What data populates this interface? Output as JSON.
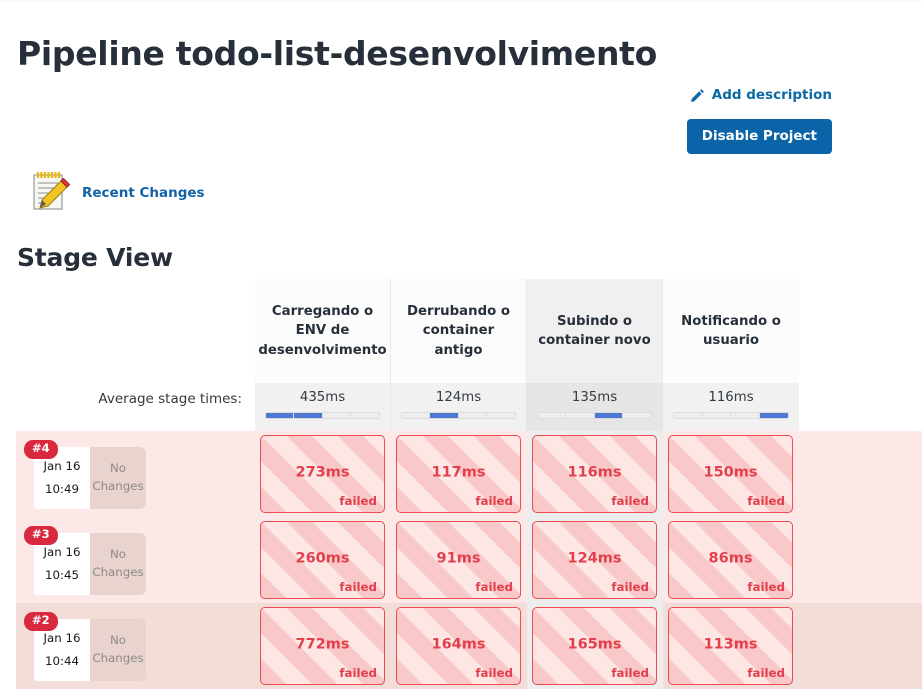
{
  "header": {
    "title": "Pipeline todo-list-desenvolvimento",
    "add_description_label": "Add description",
    "add_description_icon": "pencil-icon",
    "disable_project_label": "Disable Project",
    "accent_color": "#0b63a8",
    "link_color": "#0b6aa2"
  },
  "recent_changes": {
    "label": "Recent Changes",
    "icon": "notepad-pencil-icon"
  },
  "stage_view": {
    "title": "Stage View",
    "average_label": "Average stage times:",
    "stages": [
      {
        "name": "Carregando o ENV de desenvolvimento",
        "average": "435ms",
        "bar_segment": 1,
        "bar_fill_percent": 50,
        "highlighted": false
      },
      {
        "name": "Derrubando o container antigo",
        "average": "124ms",
        "bar_segment": 2,
        "bar_fill_percent": 25,
        "highlighted": false
      },
      {
        "name": "Subindo o container novo",
        "average": "135ms",
        "bar_segment": 3,
        "bar_fill_percent": 25,
        "highlighted": true
      },
      {
        "name": "Notificando o usuario",
        "average": "116ms",
        "bar_segment": 4,
        "bar_fill_percent": 25,
        "highlighted": false
      }
    ],
    "builds": [
      {
        "number": "#4",
        "date": "Jan 16",
        "time": "10:49",
        "changes_line1": "No",
        "changes_line2": "Changes",
        "hover": false,
        "cells": [
          {
            "duration": "273ms",
            "status": "failed"
          },
          {
            "duration": "117ms",
            "status": "failed"
          },
          {
            "duration": "116ms",
            "status": "failed"
          },
          {
            "duration": "150ms",
            "status": "failed"
          }
        ]
      },
      {
        "number": "#3",
        "date": "Jan 16",
        "time": "10:45",
        "changes_line1": "No",
        "changes_line2": "Changes",
        "hover": false,
        "cells": [
          {
            "duration": "260ms",
            "status": "failed"
          },
          {
            "duration": "91ms",
            "status": "failed"
          },
          {
            "duration": "124ms",
            "status": "failed"
          },
          {
            "duration": "86ms",
            "status": "failed"
          }
        ]
      },
      {
        "number": "#2",
        "date": "Jan 16",
        "time": "10:44",
        "changes_line1": "No",
        "changes_line2": "Changes",
        "hover": true,
        "cells": [
          {
            "duration": "772ms",
            "status": "failed"
          },
          {
            "duration": "164ms",
            "status": "failed"
          },
          {
            "duration": "165ms",
            "status": "failed"
          },
          {
            "duration": "113ms",
            "status": "failed"
          }
        ]
      }
    ],
    "colors": {
      "failed_border": "#ef4b53",
      "failed_text": "#e2404d",
      "build_badge": "#d9293f",
      "bar_fill": "#4f77d4",
      "row_background": "#fce8e6",
      "row_background_hover": "#f3ddd8"
    }
  }
}
